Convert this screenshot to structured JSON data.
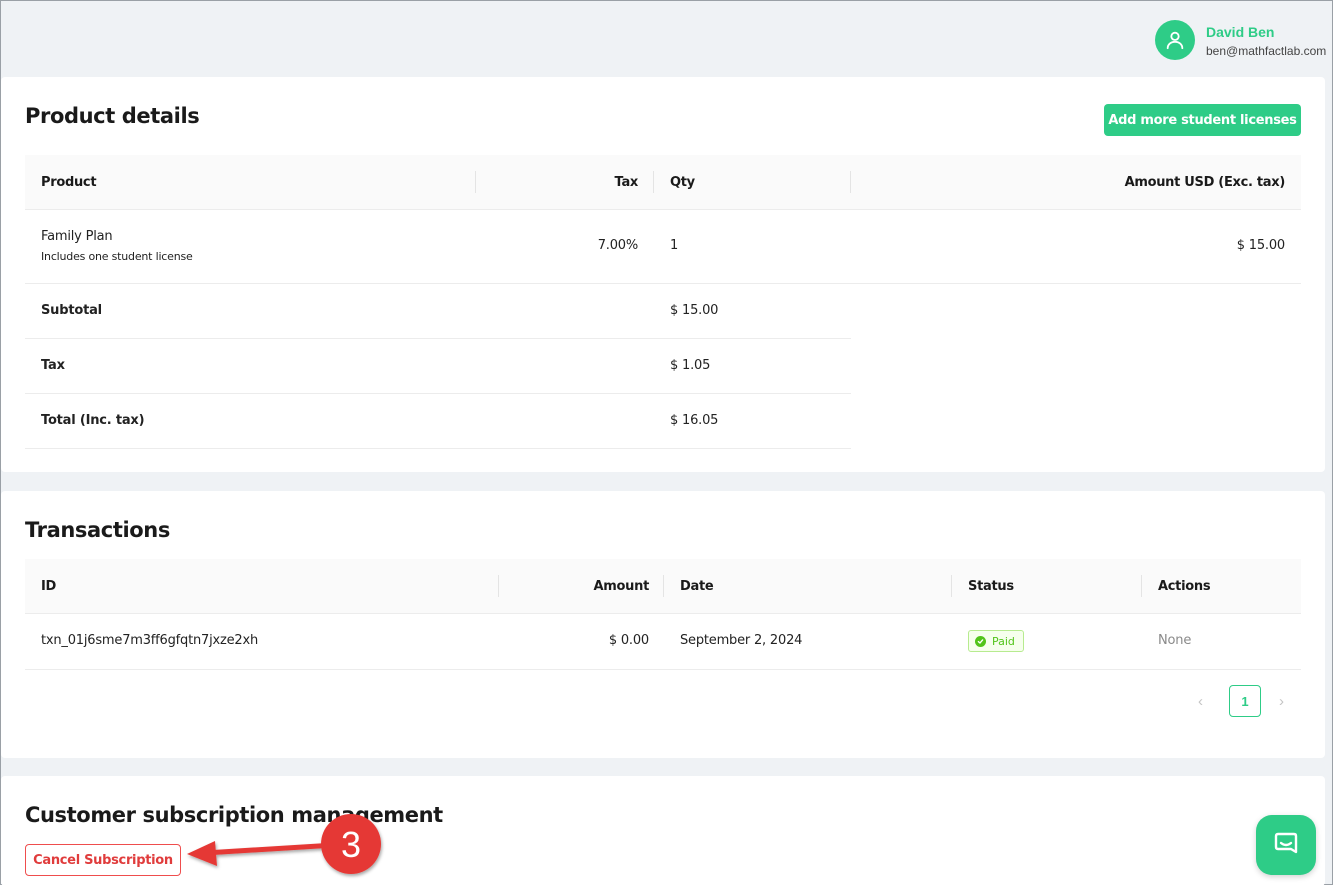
{
  "user": {
    "name": "David Ben",
    "email": "ben@mathfactlab.com"
  },
  "product_details": {
    "title": "Product details",
    "add_button": "Add more student licenses",
    "columns": [
      "Product",
      "Tax",
      "Qty",
      "Amount USD (Exc. tax)"
    ],
    "item": {
      "name": "Family Plan",
      "description": "Includes one student license",
      "tax": "7.00%",
      "qty": "1",
      "amount": "$ 15.00"
    },
    "summary": [
      {
        "label": "Subtotal",
        "value": "$ 15.00"
      },
      {
        "label": "Tax",
        "value": "$ 1.05"
      },
      {
        "label": "Total (Inc. tax)",
        "value": "$ 16.05"
      }
    ]
  },
  "transactions": {
    "title": "Transactions",
    "columns": [
      "ID",
      "Amount",
      "Date",
      "Status",
      "Actions"
    ],
    "rows": [
      {
        "id": "txn_01j6sme7m3ff6gfqtn7jxze2xh",
        "amount": "$ 0.00",
        "date": "September 2, 2024",
        "status": "Paid",
        "actions": "None"
      }
    ],
    "pagination": {
      "current": "1",
      "prev_icon": "chevron-left-icon",
      "next_icon": "chevron-right-icon"
    }
  },
  "customer": {
    "title": "Customer subscription management",
    "cancel_button": "Cancel Subscription"
  },
  "annotation": {
    "step_number": "3"
  },
  "colors": {
    "accent": "#2ecc87",
    "danger": "#e03c3c",
    "annotation": "#e53935",
    "paid": "#52c41a"
  }
}
